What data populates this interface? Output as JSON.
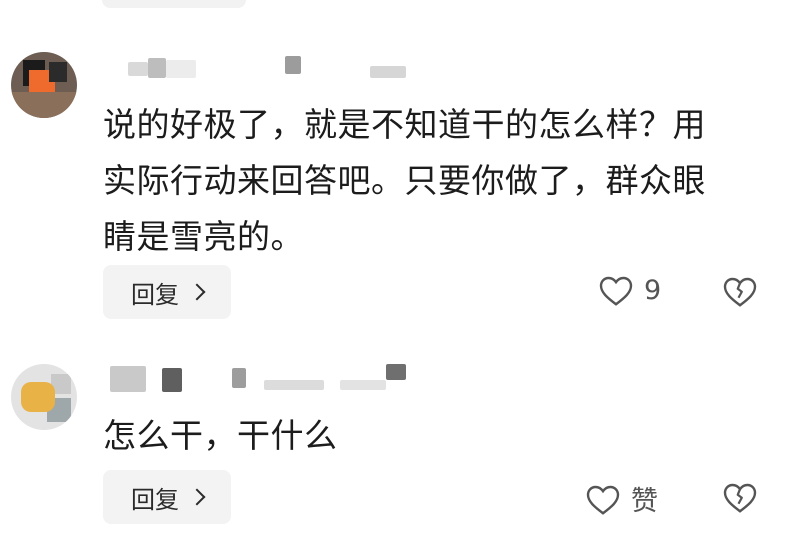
{
  "comments": [
    {
      "text_line1": "说的好极了，就是不知道干的怎么样？用",
      "text_line2": "实际行动来回答吧。只要你做了，群众眼",
      "text_line3": "睛是雪亮的。",
      "reply_label": "回复",
      "like_count": "9",
      "like_icon": "heart-outline-icon",
      "dislike_icon": "broken-heart-icon"
    },
    {
      "text_line1": "怎么干，干什么",
      "reply_label": "回复",
      "like_label": "赞",
      "like_icon": "heart-outline-icon",
      "dislike_icon": "broken-heart-icon"
    }
  ],
  "colors": {
    "background": "#ffffff",
    "text": "#1c1c1c",
    "reply_bg": "#f3f3f3",
    "icon": "#555555"
  }
}
